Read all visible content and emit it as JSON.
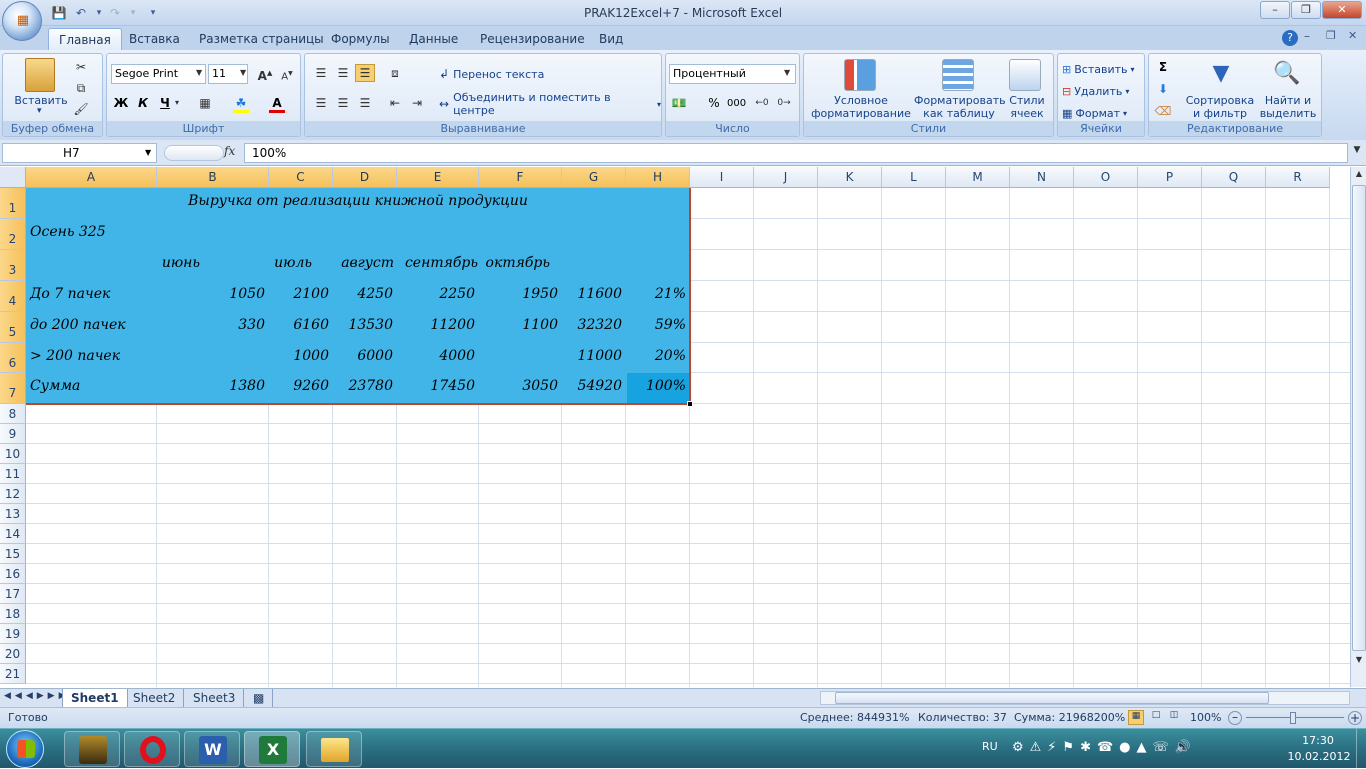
{
  "window": {
    "title": "PRAK12Excel+7 - Microsoft Excel",
    "min_label": "–",
    "max_label": "❐",
    "close_label": "✕"
  },
  "tabs": [
    {
      "label": "Главная"
    },
    {
      "label": "Вставка"
    },
    {
      "label": "Разметка страницы"
    },
    {
      "label": "Формулы"
    },
    {
      "label": "Данные"
    },
    {
      "label": "Рецензирование"
    },
    {
      "label": "Вид"
    }
  ],
  "ribbon": {
    "clipboard": {
      "paste_label": "Вставить",
      "group_label": "Буфер обмена"
    },
    "font": {
      "font_name": "Segoe Print",
      "font_size": "11",
      "bold": "Ж",
      "italic": "К",
      "underline": "Ч",
      "group_label": "Шрифт"
    },
    "alignment": {
      "wrap_text": "Перенос текста",
      "merge_center": "Объединить и поместить в центре",
      "group_label": "Выравнивание"
    },
    "number": {
      "format": "Процентный",
      "percent": "%",
      "thousands": "000",
      "group_label": "Число"
    },
    "styles": {
      "conditional": "Условное форматирование",
      "as_table": "Форматировать как таблицу",
      "cell_styles": "Стили ячеек",
      "group_label": "Стили"
    },
    "cells": {
      "insert": "Вставить",
      "delete": "Удалить",
      "format": "Формат",
      "group_label": "Ячейки"
    },
    "editing": {
      "sort_filter": "Сортировка и фильтр",
      "find_select": "Найти и выделить",
      "group_label": "Редактирование"
    }
  },
  "formula_bar": {
    "name_box": "H7",
    "fx": "fx",
    "value": "100%"
  },
  "columns": [
    "A",
    "B",
    "C",
    "D",
    "E",
    "F",
    "G",
    "H",
    "I",
    "J",
    "K",
    "L",
    "M",
    "N",
    "O",
    "P",
    "Q",
    "R"
  ],
  "rows": [
    "1",
    "2",
    "3",
    "4",
    "5",
    "6",
    "7",
    "8",
    "9",
    "10",
    "11",
    "12",
    "13",
    "14",
    "15",
    "16",
    "17",
    "18",
    "19",
    "20",
    "21"
  ],
  "sheet": {
    "title": "Выручка от реализации книжной продукции",
    "subtitle": "Осень 325",
    "months": [
      "июнь",
      "июль",
      "август",
      "сентябрь",
      "октябрь"
    ],
    "data_rows": [
      {
        "label": "До 7 пачек",
        "values": [
          "1050",
          "2100",
          "4250",
          "2250",
          "1950",
          "11600",
          "21%"
        ]
      },
      {
        "label": "до 200 пачек",
        "values": [
          "330",
          "6160",
          "13530",
          "11200",
          "1100",
          "32320",
          "59%"
        ]
      },
      {
        "label": "> 200 пачек",
        "values": [
          "",
          "1000",
          "6000",
          "4000",
          "",
          "11000",
          "20%"
        ]
      },
      {
        "label": "Сумма",
        "values": [
          "1380",
          "9260",
          "23780",
          "17450",
          "3050",
          "54920",
          "100%"
        ]
      }
    ]
  },
  "sheet_tabs": [
    "Sheet1",
    "Sheet2",
    "Sheet3"
  ],
  "status": {
    "ready": "Готово",
    "average": "Среднее: 844931%",
    "count": "Количество: 37",
    "sum": "Сумма: 21968200%",
    "zoom": "100%"
  },
  "taskbar": {
    "lang": "RU",
    "time": "17:30",
    "date": "10.02.2012"
  },
  "colors": {
    "selection_fill": "#41b5e8",
    "active_cell": "#16a3e0",
    "tab_active": "#ffffff"
  }
}
